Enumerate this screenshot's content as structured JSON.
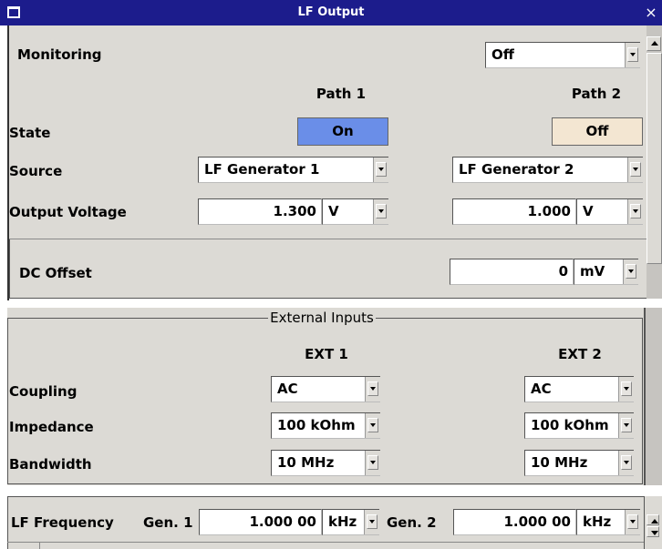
{
  "window": {
    "title": "LF Output",
    "close_glyph": "×",
    "titlebar_color": "#1c1c8c",
    "system_icon": "window-menu-icon"
  },
  "monitoring": {
    "label": "Monitoring",
    "value": "Off"
  },
  "paths": {
    "header1": "Path 1",
    "header2": "Path 2",
    "state_label": "State",
    "state1": "On",
    "state1_color": "#6a8ee8",
    "state2": "Off",
    "state2_color": "#f3e6d2",
    "source_label": "Source",
    "source1": "LF Generator 1",
    "source2": "LF Generator 2",
    "voltage_label": "Output Voltage",
    "voltage1": "1.300",
    "voltage1_unit": "V",
    "voltage2": "1.000",
    "voltage2_unit": "V"
  },
  "dc_offset": {
    "label": "DC Offset",
    "value": "0",
    "unit": "mV"
  },
  "external_inputs": {
    "title": "External Inputs",
    "header1": "EXT 1",
    "header2": "EXT 2",
    "coupling_label": "Coupling",
    "coupling1": "AC",
    "coupling2": "AC",
    "impedance_label": "Impedance",
    "impedance1": "100 kOhm",
    "impedance2": "100 kOhm",
    "bandwidth_label": "Bandwidth",
    "bandwidth1": "10 MHz",
    "bandwidth2": "10 MHz"
  },
  "lf_frequency": {
    "label": "LF Frequency",
    "gen1_label": "Gen. 1",
    "gen1_value": "1.000 00",
    "gen1_unit": "kHz",
    "gen2_label": "Gen. 2",
    "gen2_value": "1.000 00",
    "gen2_unit": "kHz"
  }
}
